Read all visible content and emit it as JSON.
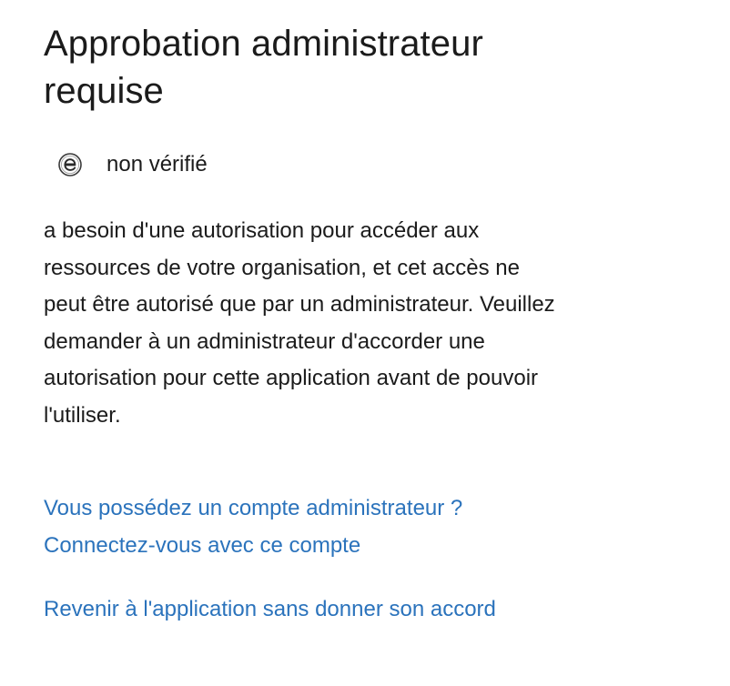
{
  "header": {
    "title_line1": "Approbation administrateur",
    "title_line2": "requise"
  },
  "app": {
    "icon": "edge-icon",
    "status": "non vérifié"
  },
  "description": {
    "lines": [
      "a besoin d'une autorisation pour accéder aux",
      "ressources de votre organisation, et cet accès ne",
      "peut être autorisé que par un administrateur. Veuillez",
      "demander à un administrateur d'accorder une",
      "autorisation pour cette application avant de pouvoir",
      "l'utiliser."
    ]
  },
  "links": {
    "admin_account_line1": "Vous possédez un compte administrateur ?",
    "admin_account_line2": "Connectez-vous avec ce compte",
    "go_back": "Revenir à l'application sans donner son accord"
  },
  "colors": {
    "text": "#1b1b1b",
    "link": "#2b73bc",
    "background": "#ffffff"
  }
}
